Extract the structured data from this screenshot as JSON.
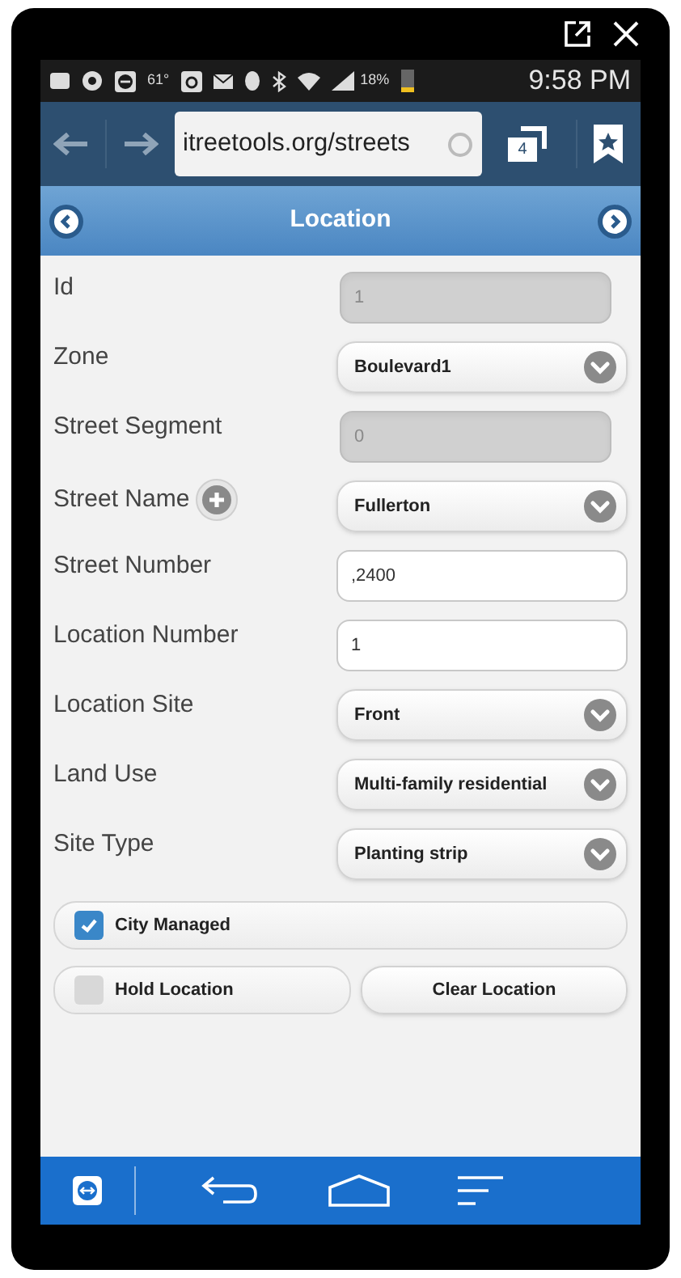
{
  "status_bar": {
    "temperature": "61°",
    "battery": "18%",
    "time": "9:58 PM"
  },
  "browser": {
    "url": "itreetools.org/streets",
    "tab_count": "4"
  },
  "header": {
    "title": "Location"
  },
  "fields": [
    {
      "label": "Id",
      "kind": "disabled",
      "value": "1"
    },
    {
      "label": "Zone",
      "kind": "select",
      "value": "Boulevard1"
    },
    {
      "label": "Street Segment",
      "kind": "disabled",
      "value": "0"
    },
    {
      "label": "Street Name",
      "kind": "select",
      "value": "Fullerton",
      "add_button": true
    },
    {
      "label": "Street Number",
      "kind": "text",
      "value": ",2400"
    },
    {
      "label": "Location Number",
      "kind": "text",
      "value": "1"
    },
    {
      "label": "Location Site",
      "kind": "select",
      "value": "Front"
    },
    {
      "label": "Land Use",
      "kind": "select",
      "value": "Multi-family residential"
    },
    {
      "label": "Site Type",
      "kind": "select",
      "value": "Planting strip"
    }
  ],
  "city_managed": {
    "label": "City Managed",
    "checked": true
  },
  "hold_location": {
    "label": "Hold Location",
    "checked": false
  },
  "clear_button": {
    "label": "Clear Location"
  }
}
